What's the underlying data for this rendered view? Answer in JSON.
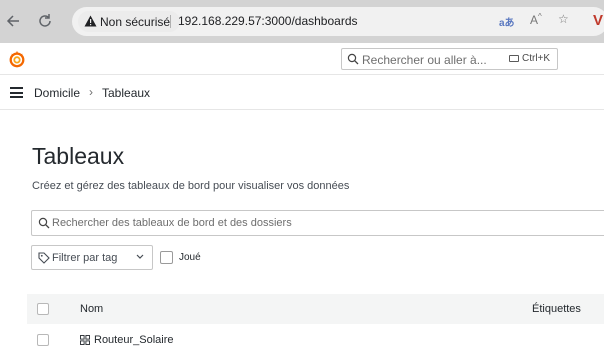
{
  "browser": {
    "security_label": "Non sécurisé",
    "url": "192.168.229.57:3000/dashboards"
  },
  "topbar": {
    "search_placeholder": "Rechercher ou aller à...",
    "shortcut": "Ctrl+K"
  },
  "breadcrumb": {
    "home": "Domicile",
    "separator": "›",
    "current": "Tableaux"
  },
  "page": {
    "title": "Tableaux",
    "subtitle": "Créez et gérez des tableaux de bord pour visualiser vos données"
  },
  "filters": {
    "search_placeholder": "Rechercher des tableaux de bord et des dossiers",
    "tag_filter": "Filtrer par tag",
    "starred": "Joué"
  },
  "table": {
    "columns": {
      "name": "Nom",
      "tags": "Étiquettes"
    },
    "rows": [
      {
        "name": "Routeur_Solaire"
      }
    ]
  },
  "colors": {
    "browser_bar": "#d3d3d3",
    "address_bg": "#f1f1f1",
    "header_row": "#f4f5f5",
    "grafana_orange": "#f46800"
  }
}
